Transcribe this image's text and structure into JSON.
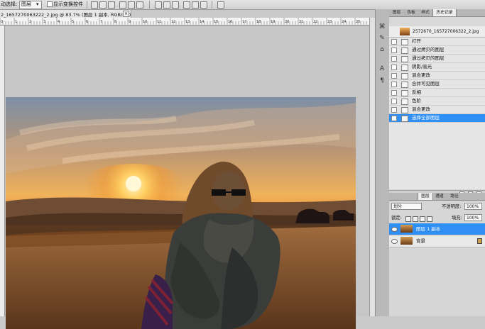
{
  "options_bar": {
    "auto_select_label": "动选择:",
    "auto_select_value": "图层",
    "show_transform_label": "显示变换控件"
  },
  "document": {
    "tab_title": "2_1657270063222_2.jpg @ 83.7% (图层 1 副本, RGB/8#)",
    "close_glyph": "×",
    "ruler_labels": [
      "0",
      "1",
      "2",
      "3",
      "4",
      "5",
      "6",
      "7",
      "8",
      "9",
      "10",
      "11",
      "12",
      "13",
      "14",
      "15",
      "16",
      "17",
      "18",
      "19",
      "20",
      "21",
      "22",
      "23",
      "24",
      "25"
    ]
  },
  "dock": {
    "icons": [
      "history-icon",
      "brush-icon",
      "clone-icon",
      "text-icon",
      "paragraph-icon"
    ]
  },
  "history_panel": {
    "tabs": [
      "图层",
      "色板",
      "样式",
      "历史记录"
    ],
    "active_tab": "历史记录",
    "snapshot_name": "2572670_165727006322_2.jpg",
    "items": [
      "打开",
      "通过拷贝的图层",
      "通过拷贝的图层",
      "阴影/高光",
      "混合更改",
      "合并可见图层",
      "反相",
      "色阶",
      "混合更改",
      "选择全部图层"
    ],
    "selected_item": "选择全部图层"
  },
  "layers_panel": {
    "tabs": [
      "图层",
      "通道",
      "路径"
    ],
    "active_tab": "图层",
    "blend_mode": "划分",
    "opacity_label": "不透明度:",
    "opacity_value": "100%",
    "lock_label": "锁定:",
    "fill_label": "填充:",
    "fill_value": "100%",
    "layers": [
      {
        "name": "图层 1 副本",
        "selected": true
      },
      {
        "name": "背景",
        "selected": false
      }
    ]
  }
}
